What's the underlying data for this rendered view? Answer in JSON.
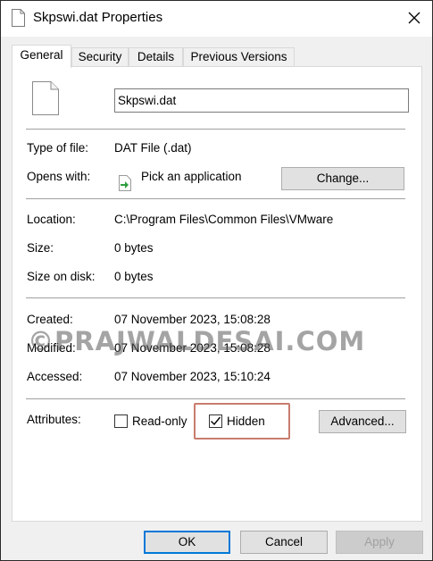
{
  "window": {
    "title": "Skpswi.dat Properties",
    "icon": "document-icon"
  },
  "tabs": [
    {
      "label": "General",
      "active": true
    },
    {
      "label": "Security",
      "active": false
    },
    {
      "label": "Details",
      "active": false
    },
    {
      "label": "Previous Versions",
      "active": false
    }
  ],
  "general": {
    "file_name": "Skpswi.dat",
    "type_label": "Type of file:",
    "type_value": "DAT File (.dat)",
    "opens_label": "Opens with:",
    "opens_value": "Pick an application",
    "change_button": "Change...",
    "location_label": "Location:",
    "location_value": "C:\\Program Files\\Common Files\\VMware",
    "size_label": "Size:",
    "size_value": "0 bytes",
    "size_disk_label": "Size on disk:",
    "size_disk_value": "0 bytes",
    "created_label": "Created:",
    "created_value": "07 November 2023, 15:08:28",
    "modified_label": "Modified:",
    "modified_value": "07 November 2023, 15:08:28",
    "accessed_label": "Accessed:",
    "accessed_value": "07 November 2023, 15:10:24",
    "attributes_label": "Attributes:",
    "readonly_label": "Read-only",
    "readonly_checked": false,
    "hidden_label": "Hidden",
    "hidden_checked": true,
    "advanced_button": "Advanced..."
  },
  "footer": {
    "ok": "OK",
    "cancel": "Cancel",
    "apply": "Apply"
  },
  "watermark": "©PRAJWALDESAI.COM",
  "colors": {
    "accent": "#0078d7",
    "highlight_box": "#c87c6e",
    "window_bg": "#f0f0f0",
    "button_bg": "#e1e1e1"
  }
}
